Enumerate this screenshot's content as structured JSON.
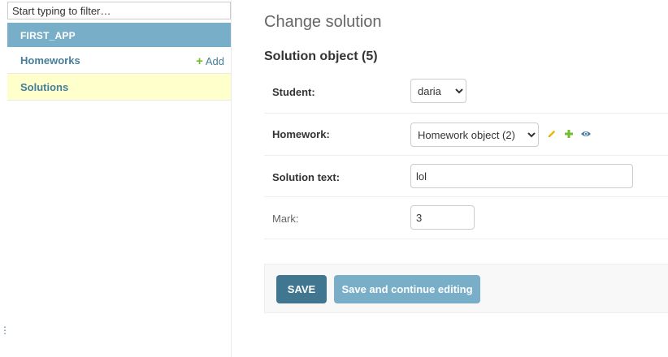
{
  "sidebar": {
    "filter_placeholder": "Start typing to filter…",
    "app_name": "FIRST_APP",
    "models": [
      {
        "label": "Homeworks",
        "add_label": "Add"
      },
      {
        "label": "Solutions"
      }
    ],
    "add_icon": "plus-icon"
  },
  "content": {
    "page_title": "Change solution",
    "object_title": "Solution object (5)",
    "fields": {
      "student": {
        "label": "Student:",
        "value": "daria"
      },
      "homework": {
        "label": "Homework:",
        "value": "Homework object (2)",
        "icons": [
          "pencil-icon",
          "plus-icon",
          "eye-icon"
        ]
      },
      "solution_text": {
        "label": "Solution text:",
        "value": "lol"
      },
      "mark": {
        "label": "Mark:",
        "value": "3"
      }
    },
    "buttons": {
      "save": "SAVE",
      "save_continue": "Save and continue editing"
    }
  },
  "colors": {
    "header": "#79aec8",
    "link": "#447e9b",
    "selected_row": "#ffffcc",
    "save_button": "#417690",
    "add_green": "#70bf2b",
    "pencil_yellow": "#efb80b"
  }
}
